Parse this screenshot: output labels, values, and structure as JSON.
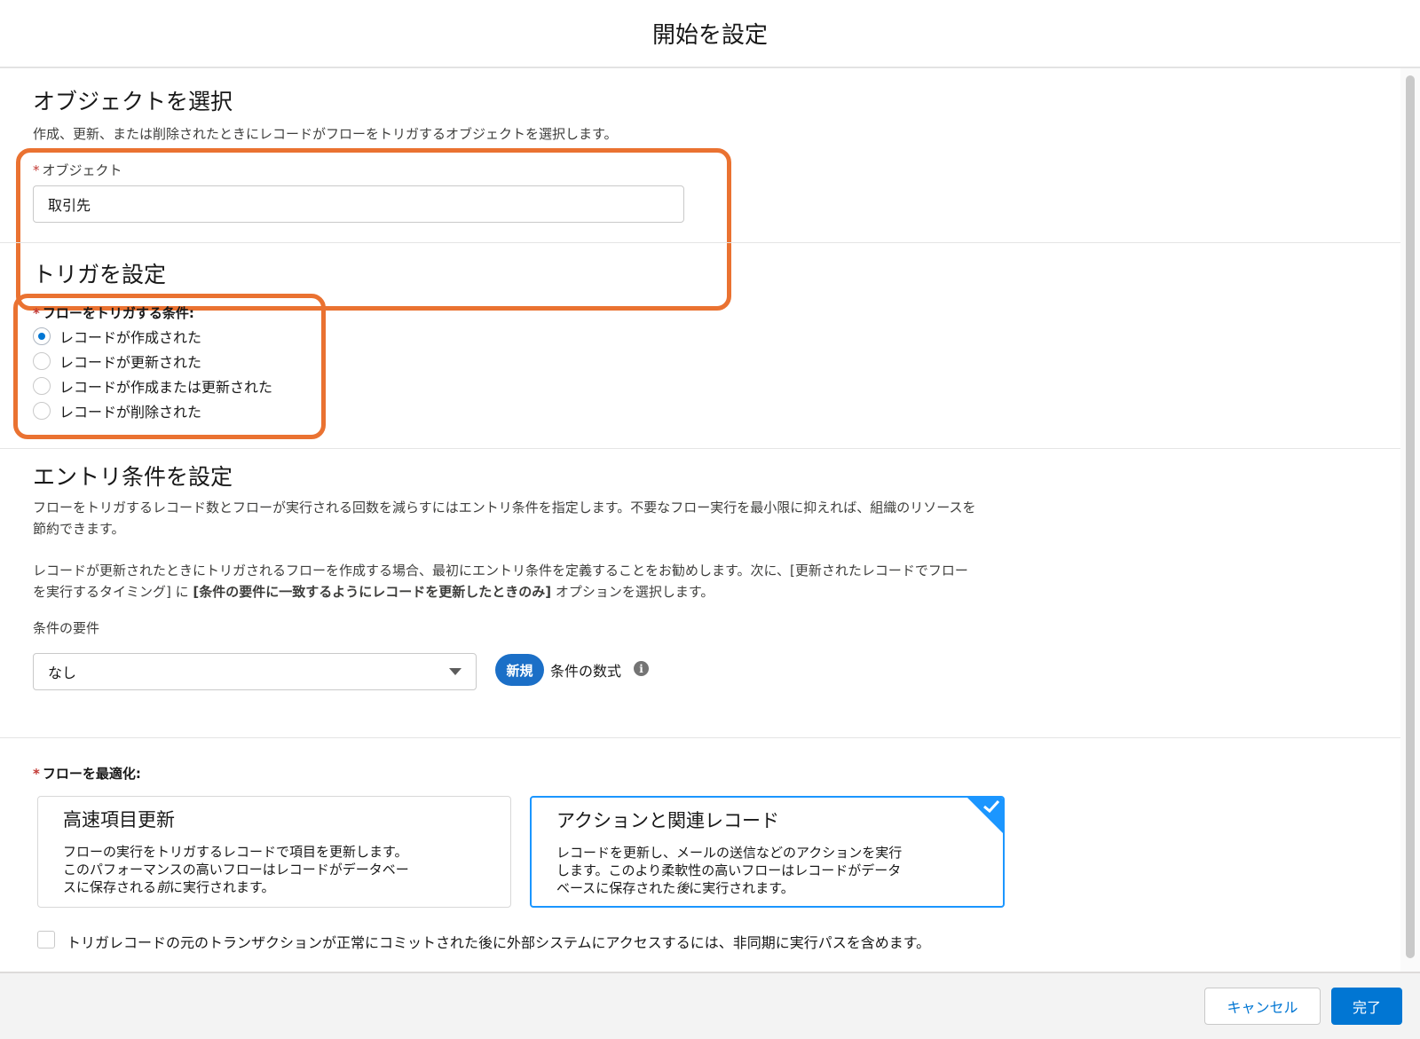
{
  "header": {
    "title": "開始を設定"
  },
  "object_section": {
    "title": "オブジェクトを選択",
    "description": "作成、更新、または削除されたときにレコードがフローをトリガするオブジェクトを選択します。",
    "field_label": "オブジェクト",
    "required_mark": "*",
    "field_value": "取引先"
  },
  "trigger_section": {
    "title": "トリガを設定",
    "required_mark": "*",
    "field_label": "フローをトリガする条件:",
    "options": [
      {
        "label": "レコードが作成された",
        "checked": true
      },
      {
        "label": "レコードが更新された",
        "checked": false
      },
      {
        "label": "レコードが作成または更新された",
        "checked": false
      },
      {
        "label": "レコードが削除された",
        "checked": false
      }
    ]
  },
  "entry_section": {
    "title": "エントリ条件を設定",
    "desc1_line1": "フローをトリガするレコード数とフローが実行される回数を減らすにはエントリ条件を指定します。不要なフロー実行を最小限に抑えれば、組織のリソースを",
    "desc1_line2": "節約できます。",
    "desc2_line1": "レコードが更新されたときにトリガされるフローを作成する場合、最初にエントリ条件を定義することをお勧めします。次に、[更新されたレコードでフロー",
    "desc2_line2_start": "を実行するタイミング] に ",
    "desc2_line2_bold": "[条件の要件に一致するようにレコードを更新したときのみ]",
    "desc2_line2_end": " オプションを選択します。",
    "condition_label": "条件の要件",
    "condition_value": "なし",
    "new_badge": "新規",
    "formula_label": "条件の数式",
    "info_icon": "i"
  },
  "optimize_section": {
    "required_mark": "*",
    "label": "フローを最適化:",
    "cards": [
      {
        "title": "高速項目更新",
        "line1": "フローの実行をトリガするレコードで項目を更新します。",
        "line2": "このパフォーマンスの高いフローはレコードがデータベー",
        "line3_start": "スに保存される",
        "line3_em": "前",
        "line3_end": "に実行されます。",
        "selected": false
      },
      {
        "title": "アクションと関連レコード",
        "line1": "レコードを更新し、メールの送信などのアクションを実行",
        "line2": "します。このより柔軟性の高いフローはレコードがデータ",
        "line3_start": "ベースに保存された",
        "line3_em": "後",
        "line3_end": "に実行されます。",
        "selected": true
      }
    ],
    "async_checkbox_label": "トリガレコードの元のトランザクションが正常にコミットされた後に外部システムにアクセスするには、非同期に実行パスを含めます。",
    "async_checked": false
  },
  "footer": {
    "cancel_label": "キャンセル",
    "done_label": "完了"
  },
  "colors": {
    "highlight": "#ea7231",
    "brand": "#0176d3",
    "selected_card": "#1b96ff",
    "required": "#c23934"
  }
}
